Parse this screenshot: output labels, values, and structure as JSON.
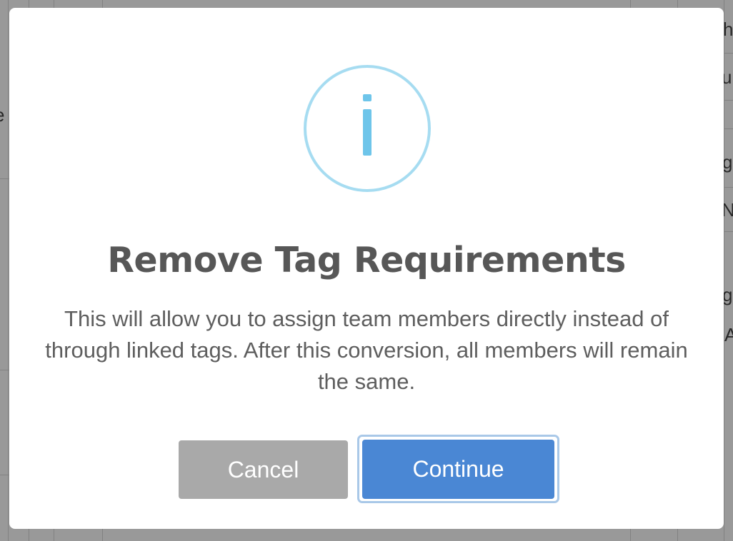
{
  "dialog": {
    "title": "Remove Tag Requirements",
    "message": "This will allow you to assign team members directly instead of through linked tags. After this conversion, all members will remain the same.",
    "cancel_label": "Cancel",
    "continue_label": "Continue",
    "icon": "info-icon"
  },
  "background": {
    "right_fragments": [
      "h",
      "u",
      "g",
      "N",
      "gr",
      "A"
    ],
    "left_fragments": [
      "e"
    ]
  },
  "colors": {
    "overlay": "#7f7f7f",
    "icon_ring": "#a6dcf1",
    "icon_glyph": "#6ec5ea",
    "title": "#575757",
    "cancel_button": "#a9a9a9",
    "continue_button": "#4a87d4"
  }
}
